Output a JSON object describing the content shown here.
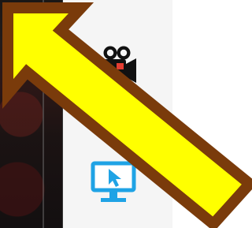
{
  "tools": [
    {
      "icon": "video-camera-icon"
    },
    {
      "icon": "screen-cursor-icon"
    }
  ],
  "colors": {
    "preview_dark": "#1b1414",
    "toolbar_bg": "#f5f5f5",
    "camera_dark": "#111111",
    "camera_red": "#e43d32",
    "screen_blue": "#1fa3e5",
    "arrow_fill": "#ffff00",
    "arrow_stroke": "#7a3b0b"
  }
}
